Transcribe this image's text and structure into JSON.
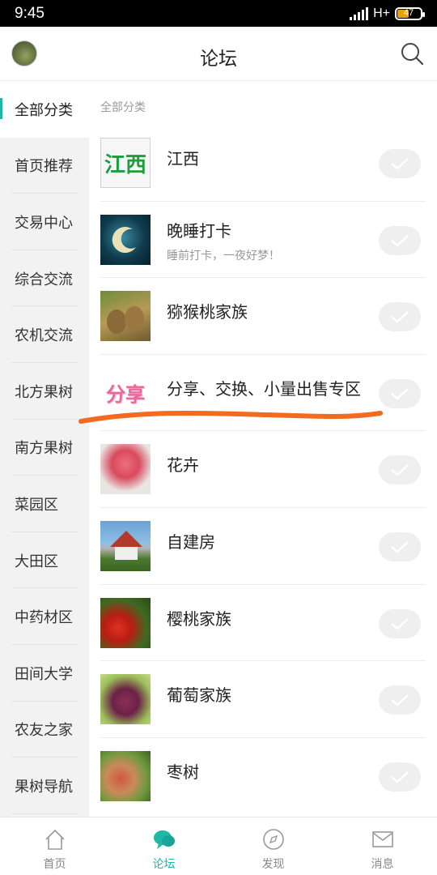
{
  "status_bar": {
    "time": "9:45",
    "network": "H+",
    "battery": "47"
  },
  "header": {
    "title": "论坛",
    "search_icon": "search-icon",
    "avatar_icon": "avatar"
  },
  "sidebar": {
    "items": [
      {
        "label": "全部分类",
        "active": true
      },
      {
        "label": "首页推荐"
      },
      {
        "label": "交易中心"
      },
      {
        "label": "综合交流"
      },
      {
        "label": "农机交流"
      },
      {
        "label": "北方果树"
      },
      {
        "label": "南方果树"
      },
      {
        "label": "菜园区"
      },
      {
        "label": "大田区"
      },
      {
        "label": "中药材区"
      },
      {
        "label": "田间大学"
      },
      {
        "label": "农友之家"
      },
      {
        "label": "果树导航"
      }
    ]
  },
  "main": {
    "section_label": "全部分类",
    "forums": [
      {
        "title": "江西",
        "thumb_text": "江西"
      },
      {
        "title": "晚睡打卡",
        "desc": "睡前打卡，一夜好梦！"
      },
      {
        "title": "猕猴桃家族"
      },
      {
        "title": "分享、交换、小量出售专区",
        "thumb_text": "分享"
      },
      {
        "title": "花卉"
      },
      {
        "title": "自建房"
      },
      {
        "title": "樱桃家族"
      },
      {
        "title": "葡萄家族"
      },
      {
        "title": "枣树"
      }
    ]
  },
  "bottom_nav": {
    "items": [
      {
        "label": "首页",
        "icon": "home-icon"
      },
      {
        "label": "论坛",
        "icon": "chat-bubble-icon",
        "active": true
      },
      {
        "label": "发现",
        "icon": "compass-icon"
      },
      {
        "label": "消息",
        "icon": "mail-icon"
      }
    ]
  },
  "colors": {
    "accent": "#1fb8a6",
    "annotation": "#f26b21"
  }
}
